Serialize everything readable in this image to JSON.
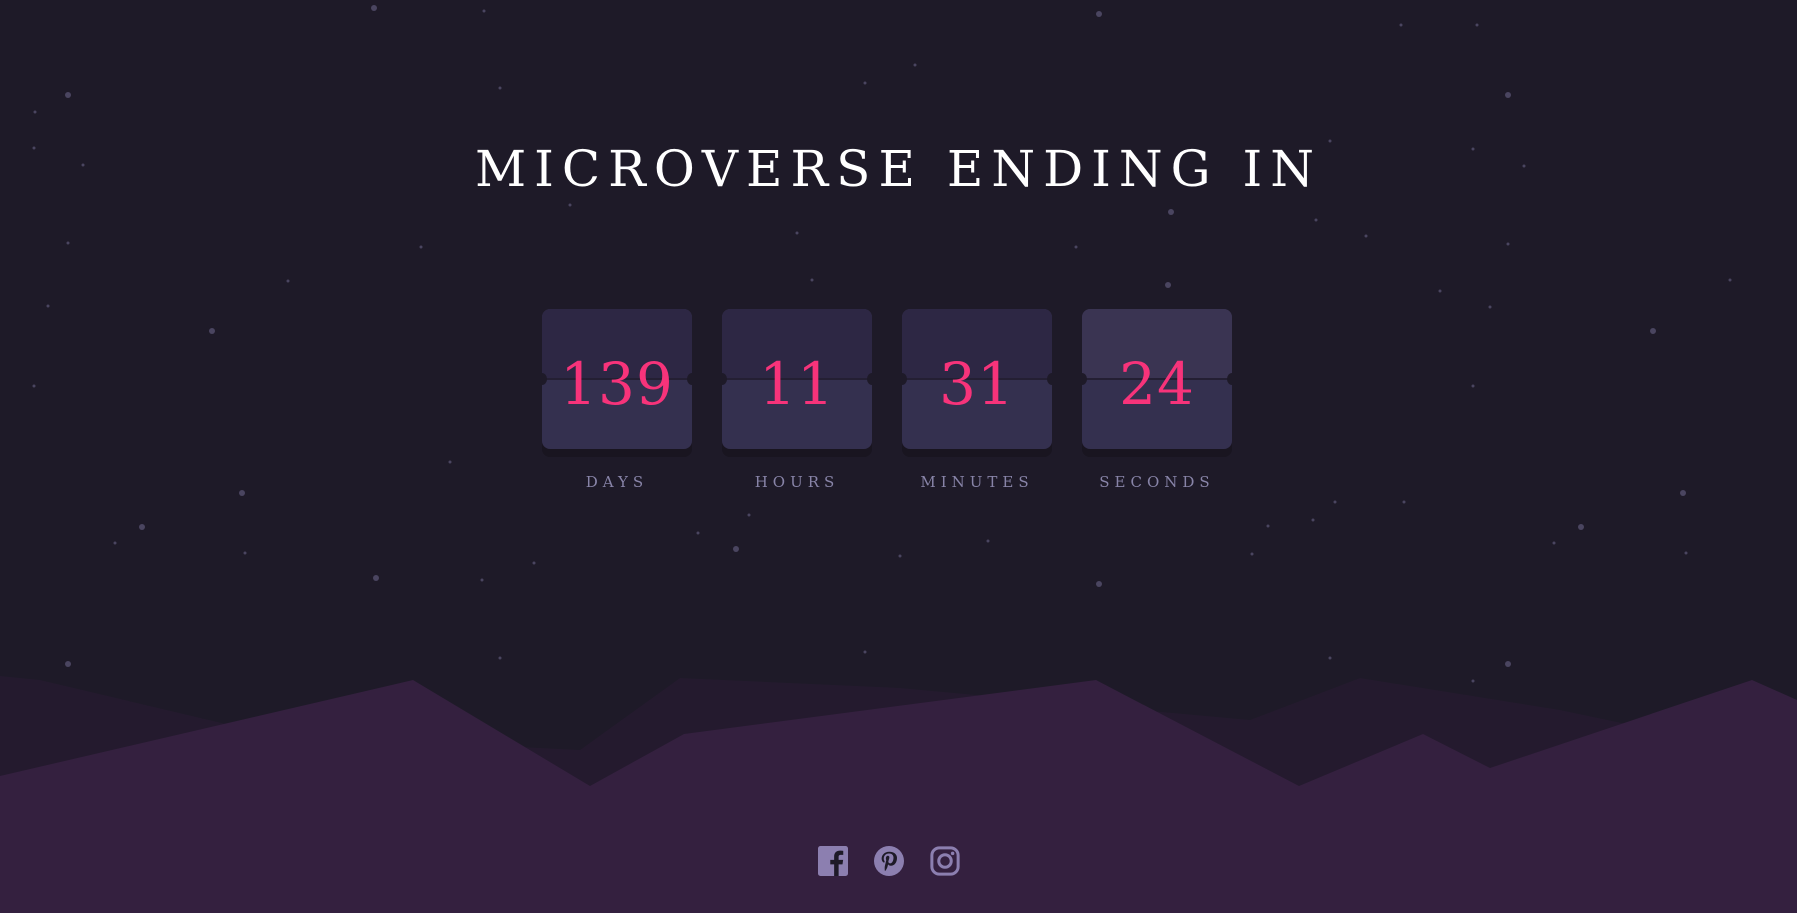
{
  "title": "MICROVERSE ENDING IN",
  "countdown": [
    {
      "value": "139",
      "label": "DAYS"
    },
    {
      "value": "11",
      "label": "HOURS"
    },
    {
      "value": "31",
      "label": "MINUTES"
    },
    {
      "value": "24",
      "label": "SECONDS"
    }
  ],
  "socials": [
    {
      "icon": "facebook-icon"
    },
    {
      "icon": "pinterest-icon"
    },
    {
      "icon": "instagram-icon"
    }
  ],
  "colors": {
    "background": "#1e1a28",
    "accent": "#f7337a",
    "card": "#34304f",
    "label": "#8884a8",
    "hills": "#34203f",
    "icon": "#8c7fb0"
  }
}
